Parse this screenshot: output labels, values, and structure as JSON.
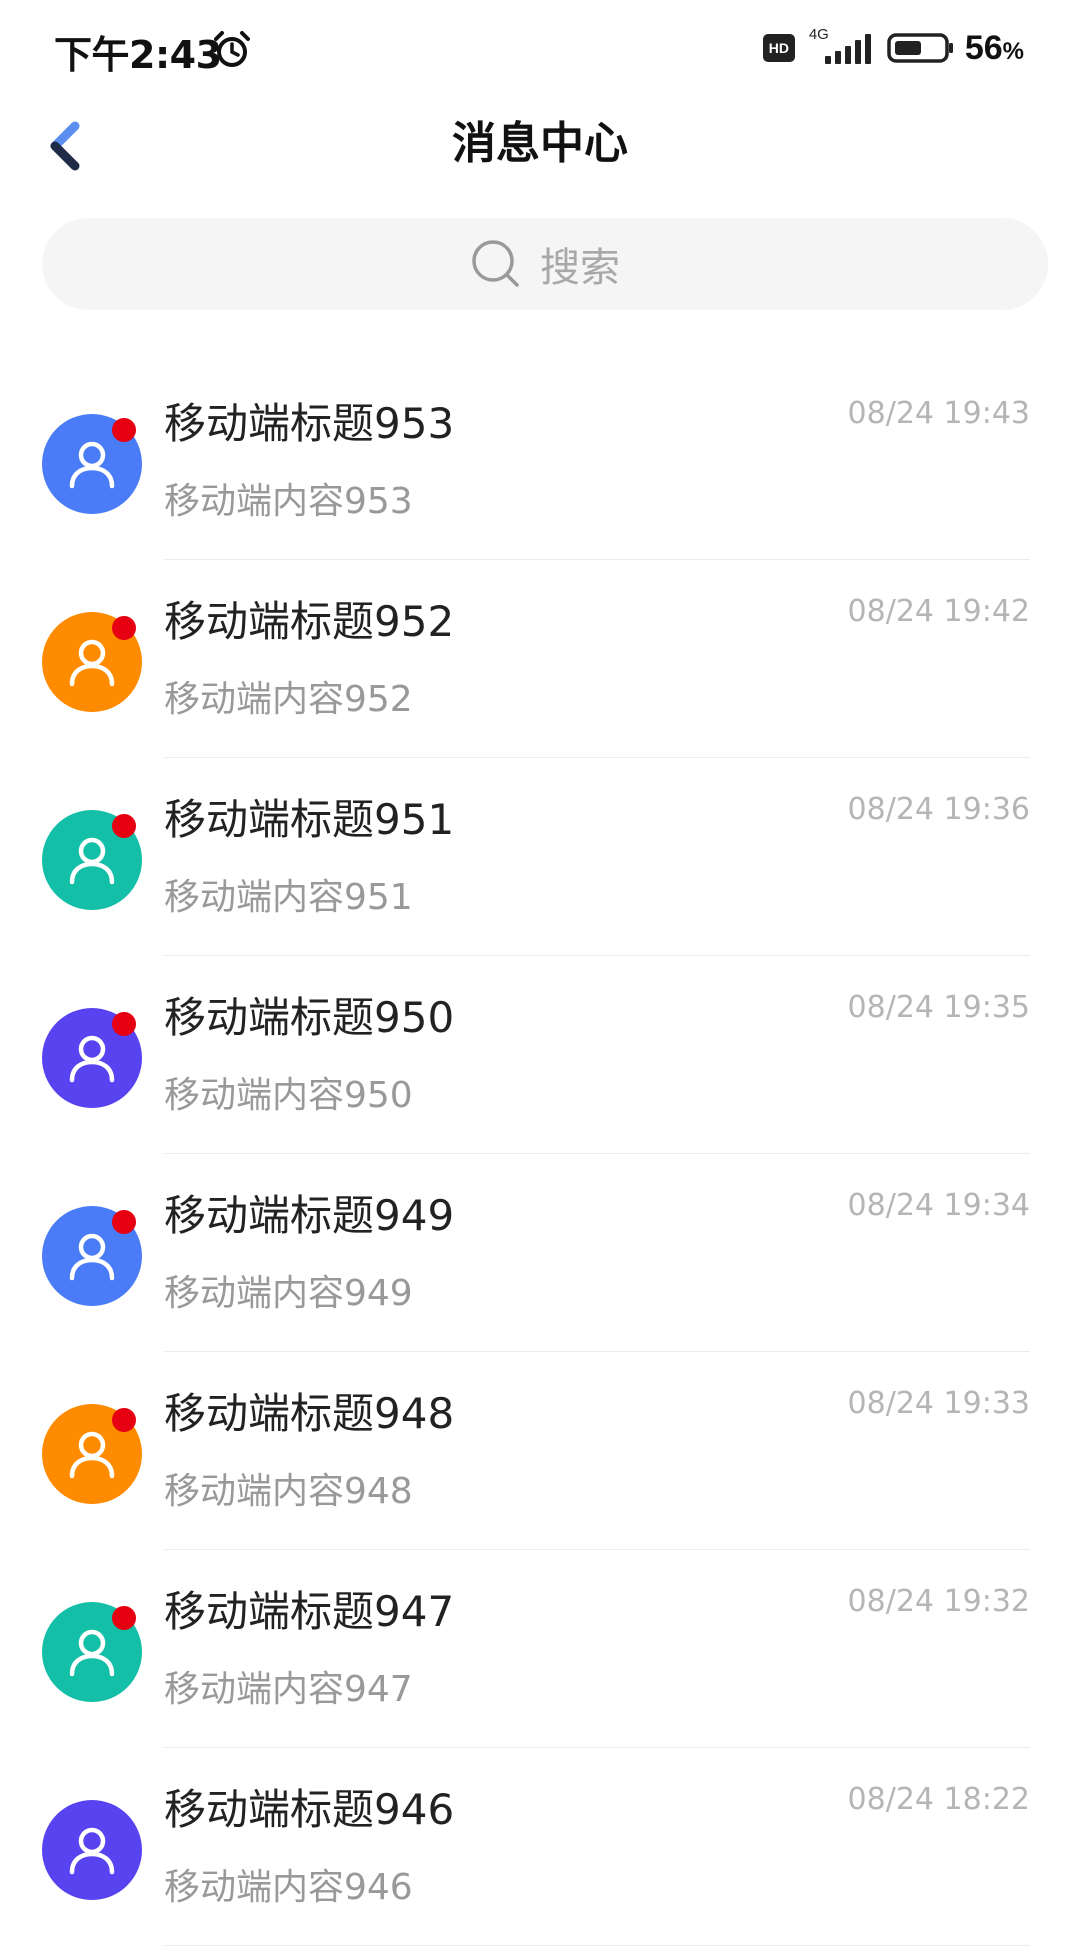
{
  "status_bar": {
    "time": "下午2:43",
    "network": "4G",
    "battery_level": "56",
    "battery_pct_sign": "%",
    "hd_label": "HD",
    "battery_fraction": 0.56
  },
  "nav": {
    "title": "消息中心"
  },
  "search": {
    "placeholder": "搜索"
  },
  "colors": {
    "blue": "#4a7cf7",
    "orange": "#ff8c00",
    "teal": "#14bfa8",
    "purple": "#5843f0",
    "unread": "#e60012"
  },
  "messages": [
    {
      "title": "移动端标题953",
      "content": "移动端内容953",
      "time": "08/24 19:43",
      "avatar_color": "#4a7cf7",
      "unread": true
    },
    {
      "title": "移动端标题952",
      "content": "移动端内容952",
      "time": "08/24 19:42",
      "avatar_color": "#ff8c00",
      "unread": true
    },
    {
      "title": "移动端标题951",
      "content": "移动端内容951",
      "time": "08/24 19:36",
      "avatar_color": "#14bfa8",
      "unread": true
    },
    {
      "title": "移动端标题950",
      "content": "移动端内容950",
      "time": "08/24 19:35",
      "avatar_color": "#5843f0",
      "unread": true
    },
    {
      "title": "移动端标题949",
      "content": "移动端内容949",
      "time": "08/24 19:34",
      "avatar_color": "#4a7cf7",
      "unread": true
    },
    {
      "title": "移动端标题948",
      "content": "移动端内容948",
      "time": "08/24 19:33",
      "avatar_color": "#ff8c00",
      "unread": true
    },
    {
      "title": "移动端标题947",
      "content": "移动端内容947",
      "time": "08/24 19:32",
      "avatar_color": "#14bfa8",
      "unread": true
    },
    {
      "title": "移动端标题946",
      "content": "移动端内容946",
      "time": "08/24 18:22",
      "avatar_color": "#5843f0",
      "unread": false
    }
  ]
}
